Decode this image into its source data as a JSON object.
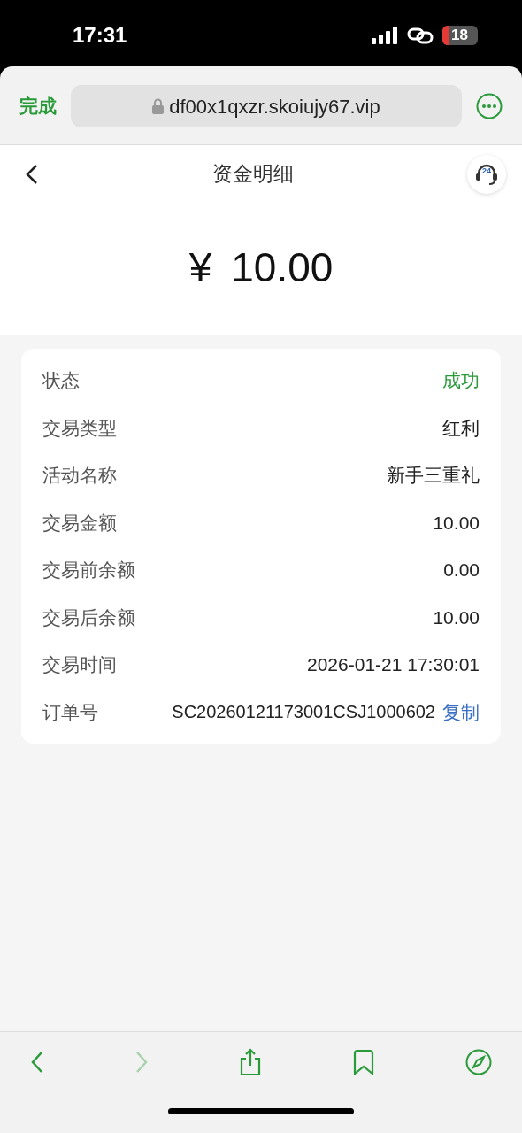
{
  "status_bar": {
    "time": "17:31",
    "battery": "18"
  },
  "browser": {
    "done": "完成",
    "url": "df00x1qxzr.skoiujy67.vip"
  },
  "header": {
    "title": "资金明细",
    "support_badge": "24"
  },
  "amount": {
    "currency": "¥",
    "value": "10.00"
  },
  "details": [
    {
      "label": "状态",
      "value": "成功",
      "kind": "status"
    },
    {
      "label": "交易类型",
      "value": "红利",
      "kind": "text"
    },
    {
      "label": "活动名称",
      "value": "新手三重礼",
      "kind": "text"
    },
    {
      "label": "交易金额",
      "value": "10.00",
      "kind": "text"
    },
    {
      "label": "交易前余额",
      "value": "0.00",
      "kind": "text"
    },
    {
      "label": "交易后余额",
      "value": "10.00",
      "kind": "text"
    },
    {
      "label": "交易时间",
      "value": "2026-01-21 17:30:01",
      "kind": "text"
    },
    {
      "label": "订单号",
      "value": "SC20260121173001CSJ1000602",
      "kind": "copy",
      "action": "复制"
    }
  ],
  "toolbar": {
    "back_disabled": false,
    "forward_disabled": true
  }
}
